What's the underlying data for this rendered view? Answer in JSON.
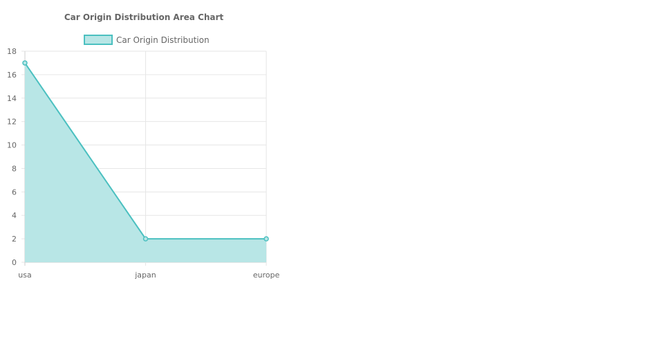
{
  "chart_data": {
    "type": "area",
    "title": "Car Origin Distribution Area Chart",
    "xlabel": "",
    "ylabel": "",
    "categories": [
      "usa",
      "japan",
      "europe"
    ],
    "series": [
      {
        "name": "Car Origin Distribution",
        "values": [
          17,
          2,
          2
        ]
      }
    ],
    "ylim": [
      0,
      18
    ],
    "yticks": [
      "0",
      "2",
      "4",
      "6",
      "8",
      "10",
      "12",
      "14",
      "16",
      "18"
    ],
    "grid": true,
    "legend": "top",
    "colors": {
      "line": "#4bc0c0",
      "fill": "#b8e6e6"
    }
  }
}
